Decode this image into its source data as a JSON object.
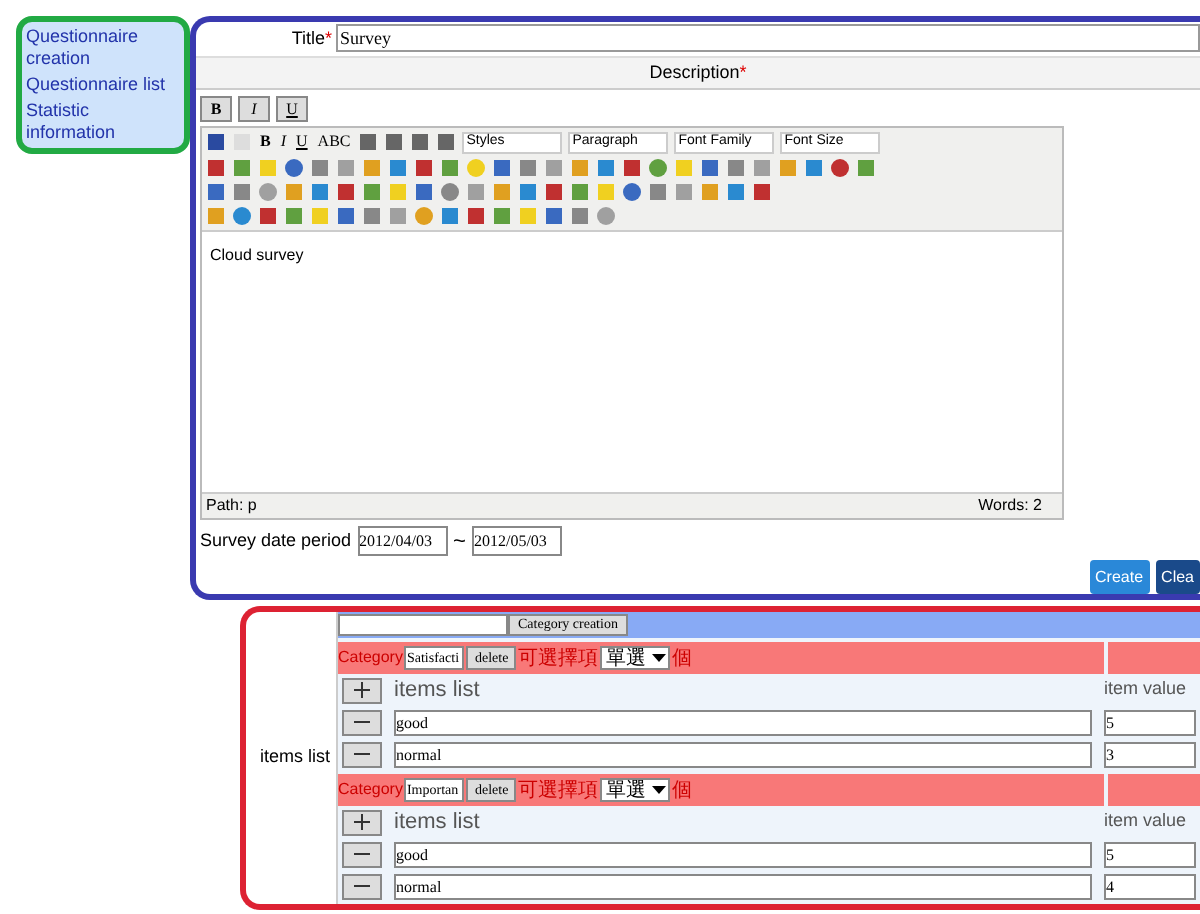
{
  "sidebar": {
    "items": [
      {
        "label": "Questionnaire creation"
      },
      {
        "label": "Questionnaire list"
      },
      {
        "label": "Statistic information"
      }
    ]
  },
  "form": {
    "title_label": "Title",
    "title_required_mark": "*",
    "title_value": "Survey",
    "description_label": "Description",
    "description_required_mark": "*",
    "format_buttons": [
      "B",
      "I",
      "U"
    ],
    "editor": {
      "text_buttons": [
        "B",
        "I",
        "U",
        "ABC"
      ],
      "dropdowns": [
        "Styles",
        "Paragraph",
        "Font Family",
        "Font Size"
      ],
      "content": "Cloud survey",
      "path": "Path: p",
      "word_count": "Words: 2"
    },
    "date_period": {
      "label": "Survey date period",
      "start": "2012/04/03",
      "separator": "~",
      "end": "2012/05/03"
    },
    "buttons": [
      "Create",
      "Clea"
    ]
  },
  "items_section": {
    "label": "items list",
    "category_creation_button": "Category creation",
    "categories": [
      {
        "label": "Category",
        "name": "Satisfacti",
        "delete_button": "delete",
        "option_label": "可選擇項",
        "option_type": "單選",
        "unit": "個",
        "items_header": "items list",
        "value_header": "item value",
        "items": [
          {
            "name": "good",
            "value": "5"
          },
          {
            "name": "normal",
            "value": "3"
          }
        ]
      },
      {
        "label": "Category",
        "name": "Importan",
        "delete_button": "delete",
        "option_label": "可選擇項",
        "option_type": "單選",
        "unit": "個",
        "items_header": "items list",
        "value_header": "item value",
        "items": [
          {
            "name": "good",
            "value": "5"
          },
          {
            "name": "normal",
            "value": "4"
          }
        ]
      }
    ]
  }
}
